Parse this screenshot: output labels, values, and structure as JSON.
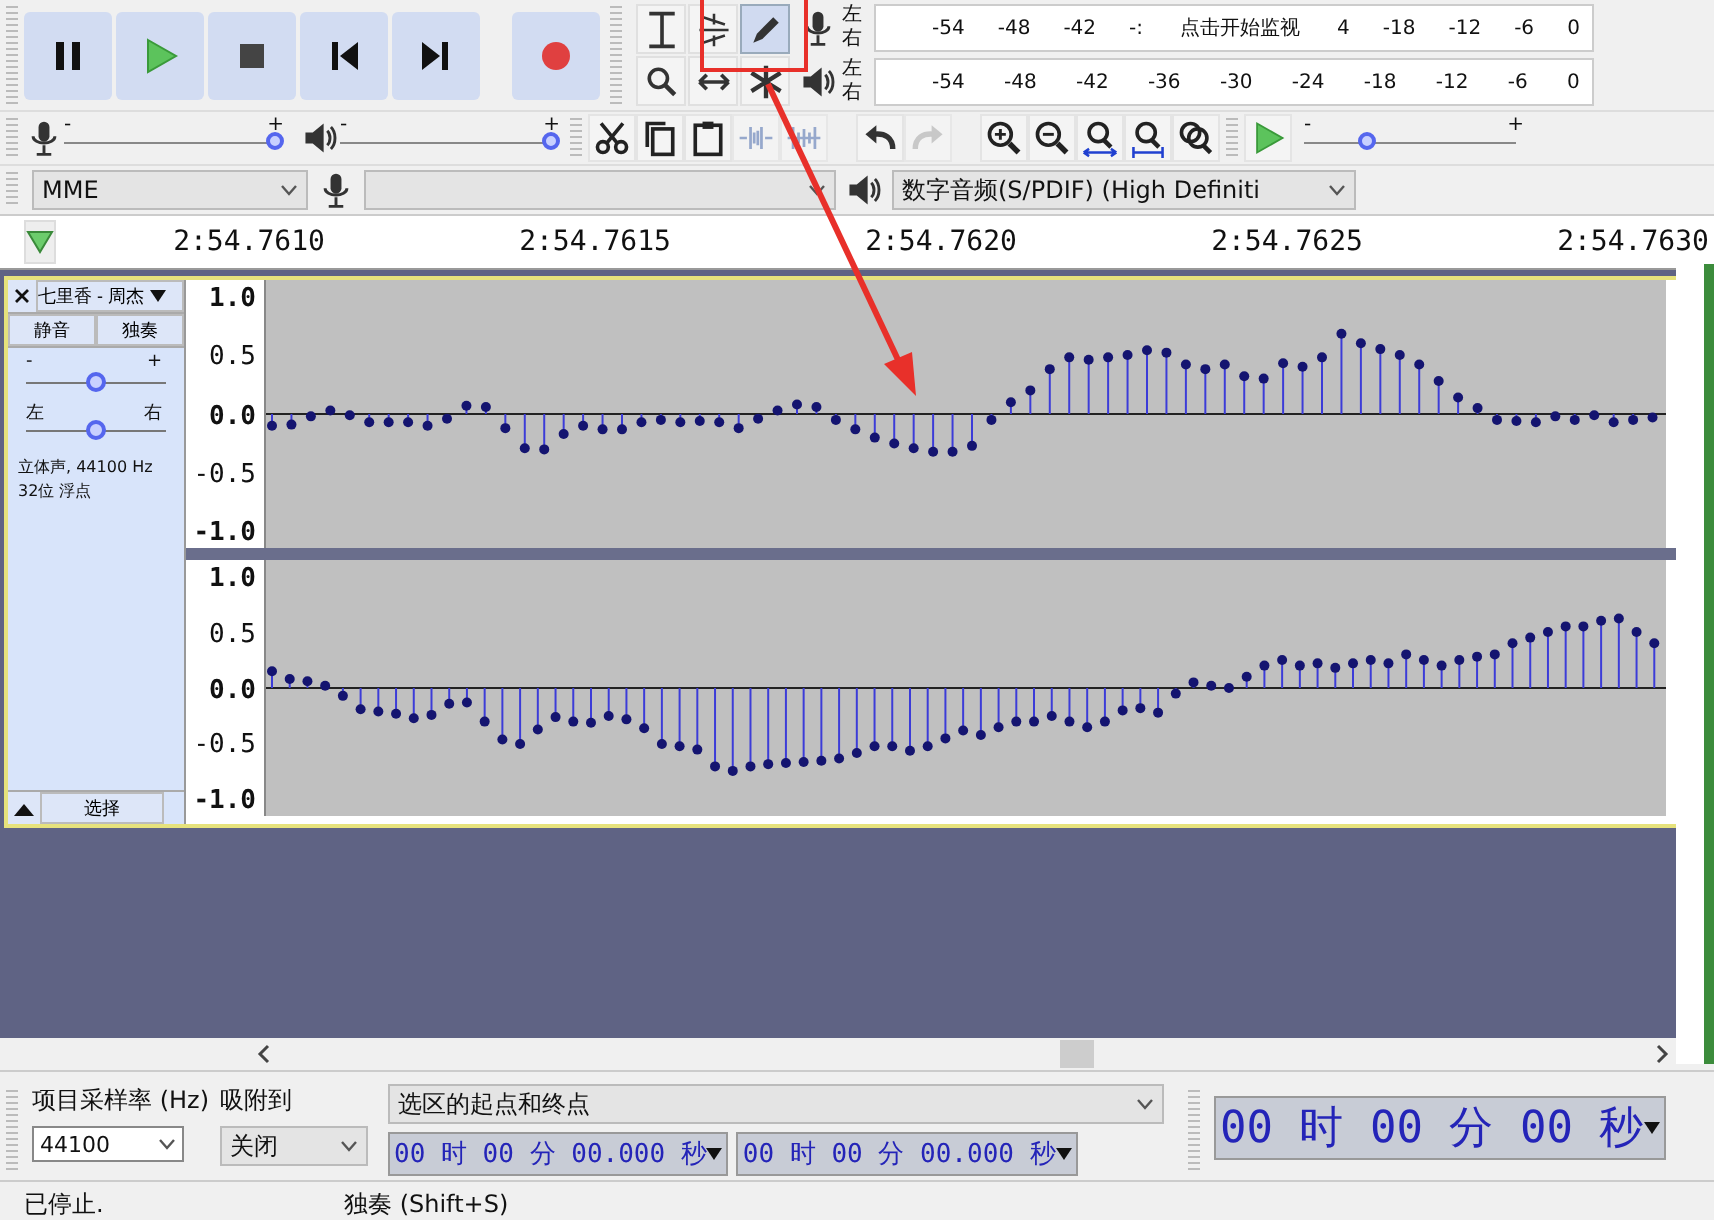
{
  "transport": [
    {
      "kind": "pause"
    },
    {
      "kind": "play"
    },
    {
      "kind": "stop"
    },
    {
      "kind": "skip-start"
    },
    {
      "kind": "skip-end"
    },
    {
      "kind": "record"
    }
  ],
  "tools": [
    {
      "kind": "select",
      "selected": false
    },
    {
      "kind": "envelope",
      "selected": false
    },
    {
      "kind": "draw",
      "selected": true
    },
    {
      "kind": "zoom",
      "selected": false
    },
    {
      "kind": "time-shift",
      "selected": false
    },
    {
      "kind": "multi",
      "selected": false
    }
  ],
  "record_meter": {
    "channels": [
      "左",
      "右"
    ],
    "scale": [
      {
        "kind": "tick",
        "text": "-54"
      },
      {
        "kind": "tick",
        "text": "-48"
      },
      {
        "kind": "tick",
        "text": "-42"
      },
      {
        "kind": "tick",
        "text": "-:"
      },
      {
        "kind": "prompt",
        "text": "点击开始监视"
      },
      {
        "kind": "tick",
        "text": "4"
      },
      {
        "kind": "tick",
        "text": "-18"
      },
      {
        "kind": "tick",
        "text": "-12"
      },
      {
        "kind": "tick",
        "text": "-6"
      },
      {
        "kind": "tick",
        "text": "0"
      }
    ]
  },
  "playback_meter": {
    "channels": [
      "左",
      "右"
    ],
    "scale": [
      {
        "kind": "tick",
        "text": "-54"
      },
      {
        "kind": "tick",
        "text": "-48"
      },
      {
        "kind": "tick",
        "text": "-42"
      },
      {
        "kind": "tick",
        "text": "-36"
      },
      {
        "kind": "tick",
        "text": "-30"
      },
      {
        "kind": "tick",
        "text": "-24"
      },
      {
        "kind": "tick",
        "text": "-18"
      },
      {
        "kind": "tick",
        "text": "-12"
      },
      {
        "kind": "tick",
        "text": "-6"
      },
      {
        "kind": "tick",
        "text": "0"
      }
    ]
  },
  "record_volume": {
    "min": "-",
    "max": "+",
    "level": 1.0
  },
  "playback_volume": {
    "min": "-",
    "max": "+",
    "level": 1.0
  },
  "edit_tools": [
    {
      "kind": "cut",
      "disabled": false
    },
    {
      "kind": "copy",
      "disabled": false
    },
    {
      "kind": "paste",
      "disabled": false
    },
    {
      "kind": "trim",
      "disabled": true
    },
    {
      "kind": "silence",
      "disabled": true
    },
    {
      "kind": "undo",
      "disabled": false
    },
    {
      "kind": "redo",
      "disabled": true
    },
    {
      "kind": "zoom-in",
      "disabled": false
    },
    {
      "kind": "zoom-out",
      "disabled": false
    },
    {
      "kind": "fit-selection",
      "disabled": false
    },
    {
      "kind": "fit-project",
      "disabled": false
    },
    {
      "kind": "zoom-toggle",
      "disabled": false
    }
  ],
  "play_at_speed": {
    "min": "-",
    "max": "+",
    "level": 0.3
  },
  "devices": {
    "host": "MME",
    "playback": "数字音频(S/PDIF) (High Definiti"
  },
  "timeline": [
    "2:54.7610",
    "2:54.7615",
    "2:54.7620",
    "2:54.7625",
    "2:54.7630"
  ],
  "track": {
    "name": "七里香 - 周杰",
    "mute": "静音",
    "solo": "独奏",
    "gain": {
      "min": "-",
      "max": "+",
      "level": 0.5
    },
    "pan": {
      "min": "左",
      "max": "右",
      "level": 0.5
    },
    "info": [
      "立体声, 44100 Hz",
      "32位 浮点"
    ],
    "select": "选择",
    "channels": [
      {
        "scale": [
          "1.0",
          "0.5",
          "0.0",
          "-0.5",
          "-1.0"
        ]
      },
      {
        "scale": [
          "1.0",
          "0.5",
          "0.0",
          "-0.5",
          "-1.0"
        ]
      }
    ]
  },
  "selection_toolbar": {
    "rate_label": "项目采样率 (Hz)",
    "rate": "44100",
    "snap_label": "吸附到",
    "snap": "关闭",
    "mode": "选区的起点和终点",
    "start": "00 时 00 分 00.000 秒",
    "end": "00 时 00 分 00.000 秒",
    "position": "00 时 00 分 00 秒"
  },
  "status_bar": [
    "已停止.",
    "独奏 (Shift+S)"
  ]
}
